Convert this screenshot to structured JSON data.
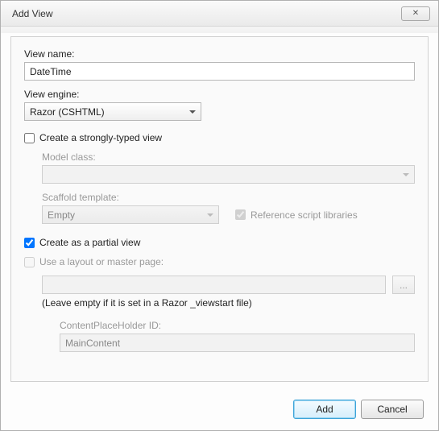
{
  "dialog": {
    "title": "Add View"
  },
  "viewName": {
    "label": "View name:",
    "value": "DateTime"
  },
  "viewEngine": {
    "label": "View engine:",
    "value": "Razor (CSHTML)"
  },
  "stronglyTyped": {
    "label": "Create a strongly-typed view",
    "checked": false
  },
  "modelClass": {
    "label": "Model class:",
    "value": ""
  },
  "scaffold": {
    "label": "Scaffold template:",
    "value": "Empty"
  },
  "referenceScripts": {
    "label": "Reference script libraries",
    "checked": true
  },
  "partialView": {
    "label": "Create as a partial view",
    "checked": true
  },
  "useLayout": {
    "label": "Use a layout or master page:",
    "checked": false,
    "value": "",
    "hint": "(Leave empty if it is set in a Razor _viewstart file)"
  },
  "contentPlaceholder": {
    "label": "ContentPlaceHolder ID:",
    "value": "MainContent"
  },
  "buttons": {
    "add": "Add",
    "cancel": "Cancel",
    "browse": "..."
  }
}
